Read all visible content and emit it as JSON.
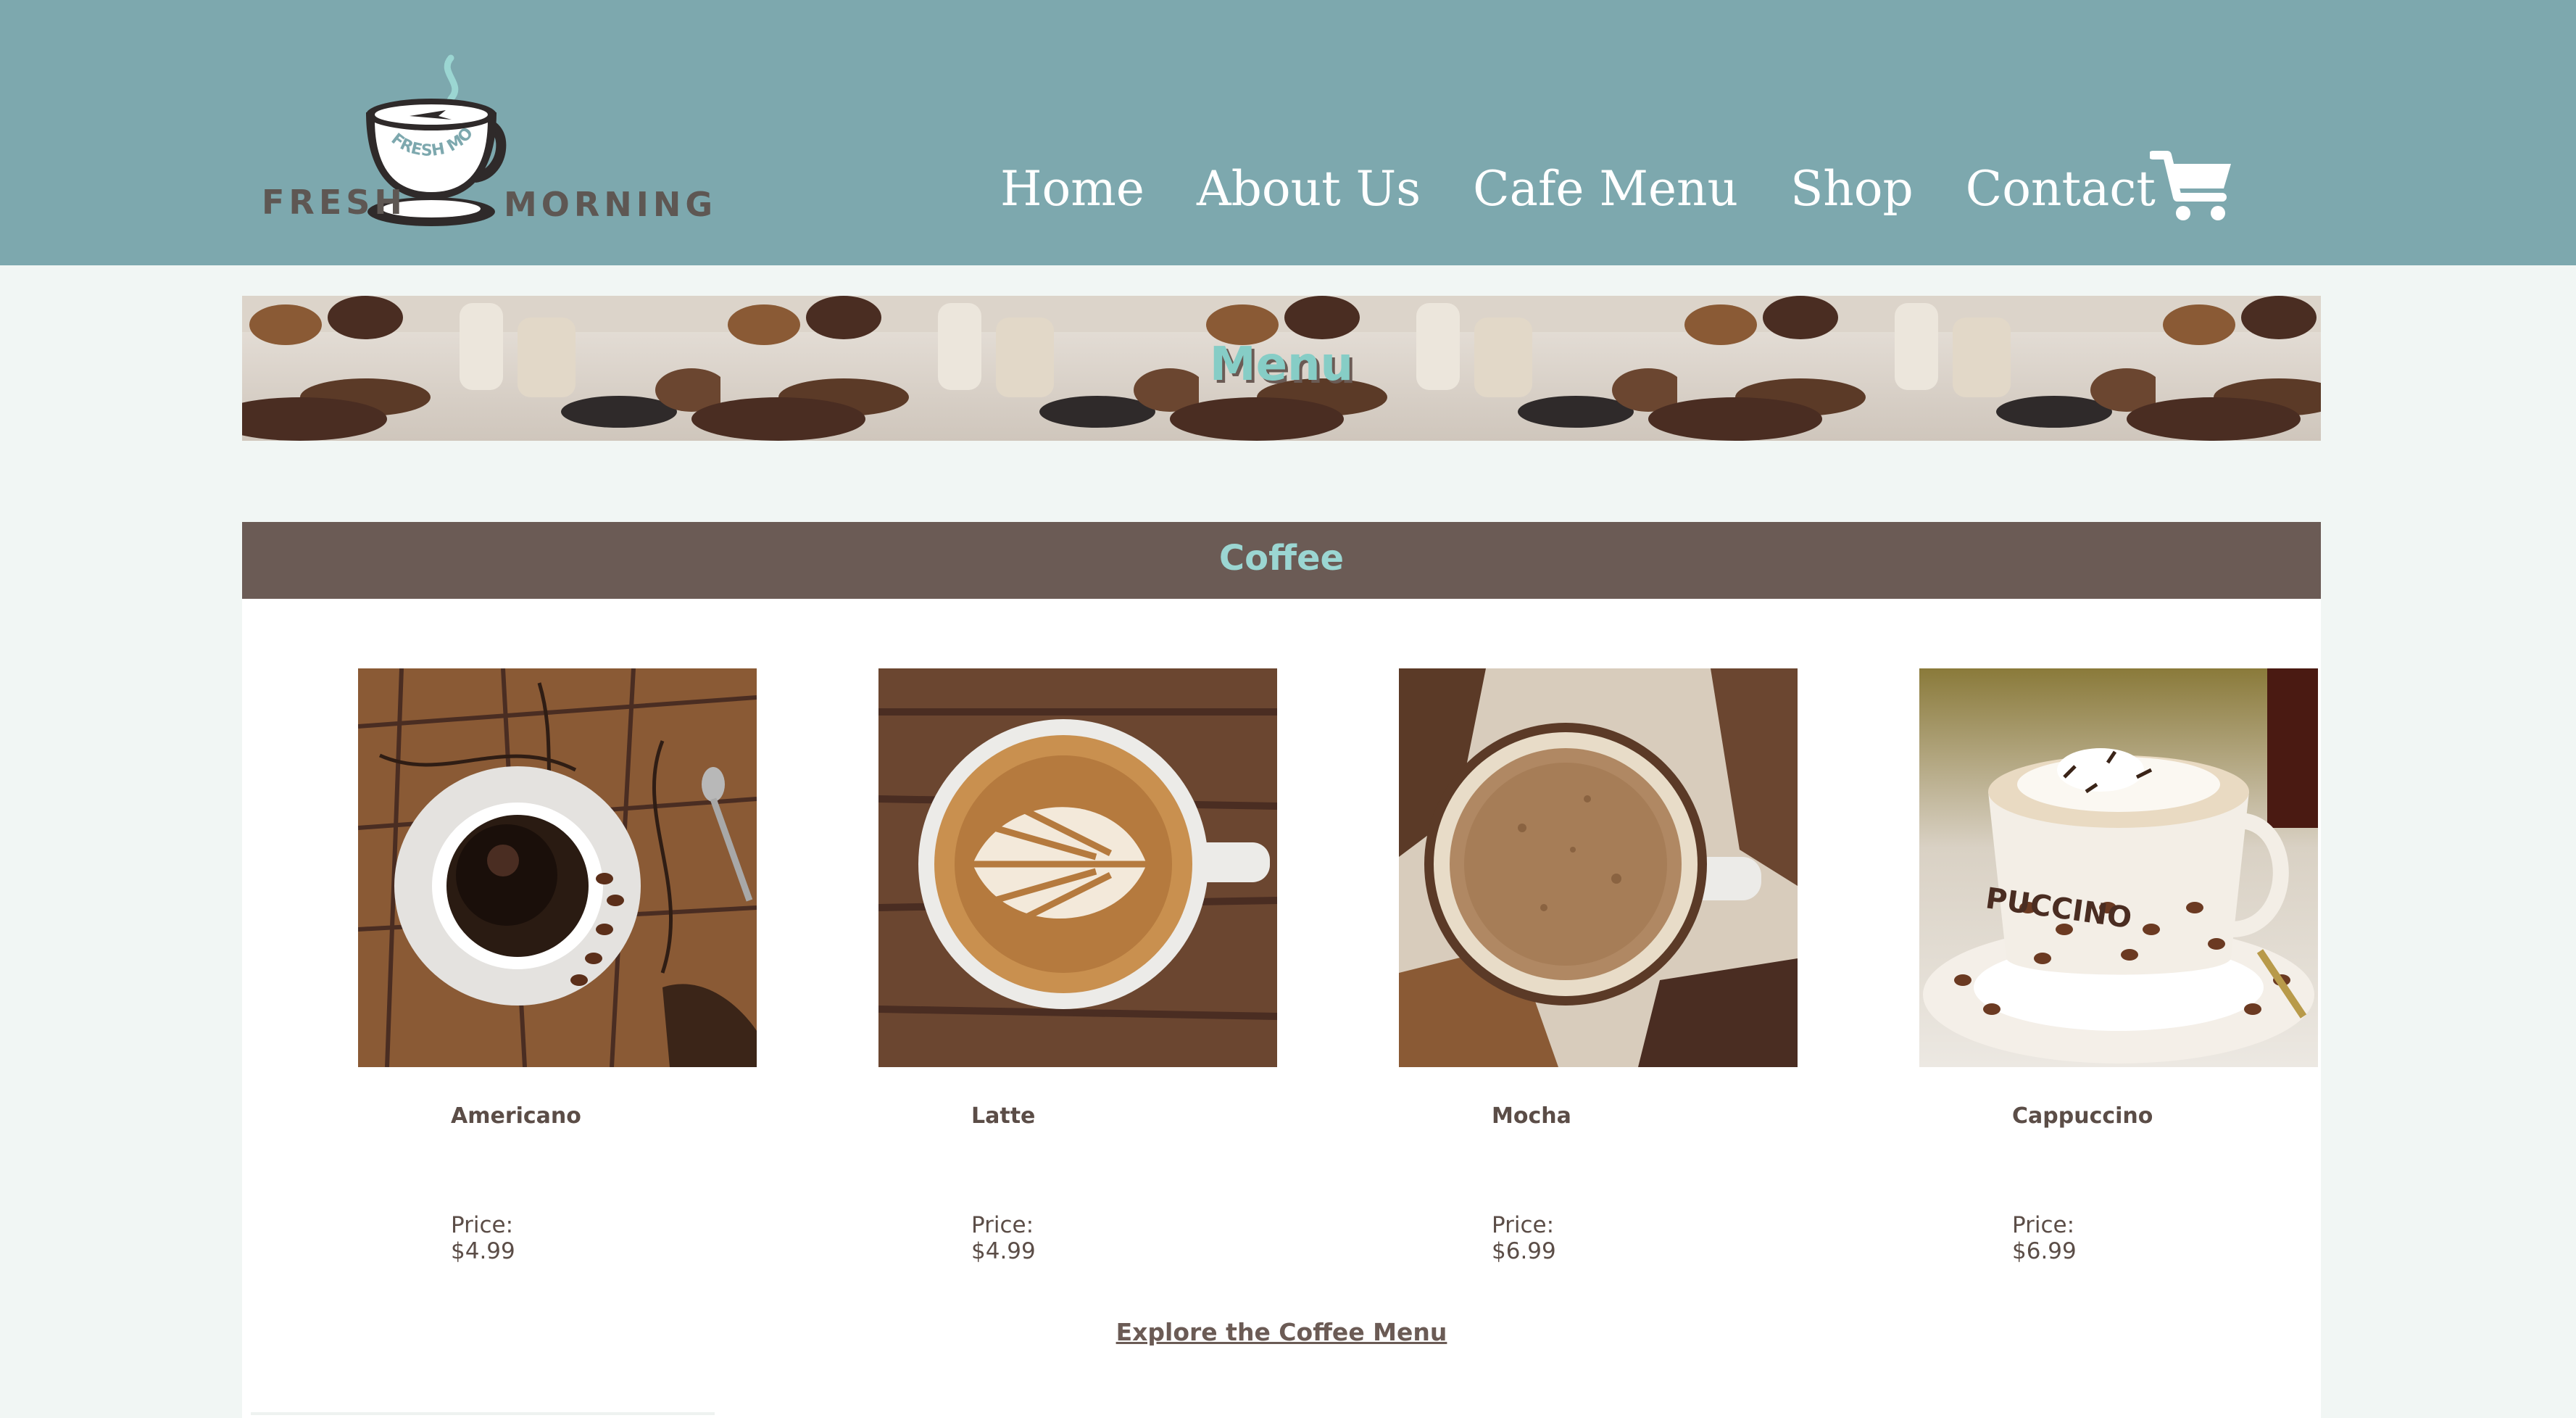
{
  "brand": {
    "logo_left": "FRESH",
    "logo_right": "MORNING",
    "logo_ring": "FRESH MORNING"
  },
  "nav": {
    "items": [
      "Home",
      "About Us",
      "Cafe Menu",
      "Shop",
      "Contact"
    ],
    "cart_icon": "shopping-cart-icon"
  },
  "banner": {
    "title": "Menu"
  },
  "coffee": {
    "title": "Coffee",
    "items": [
      {
        "name": "Americano",
        "price_label": "Price:",
        "price": "$4.99"
      },
      {
        "name": "Latte",
        "price_label": "Price:",
        "price": "$4.99"
      },
      {
        "name": "Mocha",
        "price_label": "Price:",
        "price": "$6.99"
      },
      {
        "name": "Cappuccino",
        "price_label": "Price:",
        "price": "$6.99"
      }
    ],
    "explore_link": "Explore the Coffee Menu"
  },
  "colors": {
    "header": "#7da8ae",
    "page_bg": "#f1f6f4",
    "section_head": "#6b5b55",
    "accent_teal": "#86cdc6",
    "text_brown": "#5b4d47"
  }
}
